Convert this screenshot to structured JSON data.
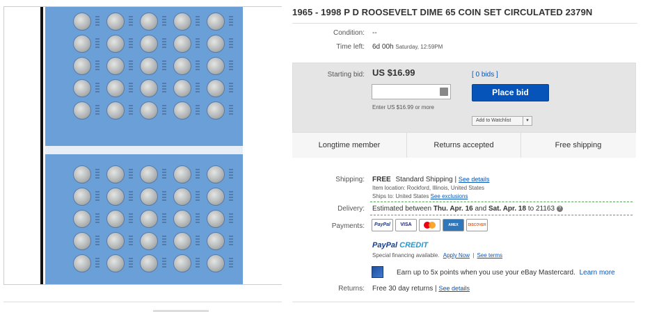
{
  "listing": {
    "title": "1965 - 1998 P D ROOSEVELT DIME 65 COIN SET CIRCULATED 2379N"
  },
  "details": {
    "condition_label": "Condition:",
    "condition_value": "--",
    "time_left_label": "Time left:",
    "time_left_value": "6d 00h",
    "time_left_end": "Saturday, 12:59PM"
  },
  "bid": {
    "starting_label": "Starting bid:",
    "amount": "US $16.99",
    "bids_text": "[ 0 bids ]",
    "input_value": "",
    "hint": "Enter US $16.99 or more",
    "place_bid_label": "Place bid",
    "watchlist_label": "Add to Watchlist"
  },
  "features": [
    "Longtime member",
    "Returns accepted",
    "Free shipping"
  ],
  "shipping": {
    "label": "Shipping:",
    "cost": "FREE",
    "method": "Standard Shipping |",
    "details_link": "See details",
    "location": "Item location:  Rockford, Illinois, United States",
    "ships_to_label": "Ships to:",
    "ships_to_value": "United States",
    "exclusions_link": "See exclusions"
  },
  "delivery": {
    "label": "Delivery:",
    "prefix": "Estimated between ",
    "start": "Thu. Apr. 16",
    "and": " and ",
    "end": "Sat. Apr. 18",
    "suffix": " to 21163"
  },
  "payments": {
    "label": "Payments:",
    "icons": [
      "PayPal",
      "VISA",
      "MasterCard",
      "AMEX",
      "DISCOVER"
    ]
  },
  "paypal_credit": {
    "brand_a": "PayPal",
    "brand_b": " CREDIT",
    "text": "Special financing available.",
    "apply_link": "Apply Now",
    "terms_link": "See terms"
  },
  "mastercard_promo": {
    "text": "Earn up to 5x points when you use your eBay Mastercard.",
    "link": "Learn more"
  },
  "returns": {
    "label": "Returns:",
    "value": "Free 30 day returns |",
    "link": "See details"
  },
  "colors": {
    "accent": "#0654ba",
    "album_blue": "#6a9fd8",
    "bid_box": "#e5e5e5"
  }
}
